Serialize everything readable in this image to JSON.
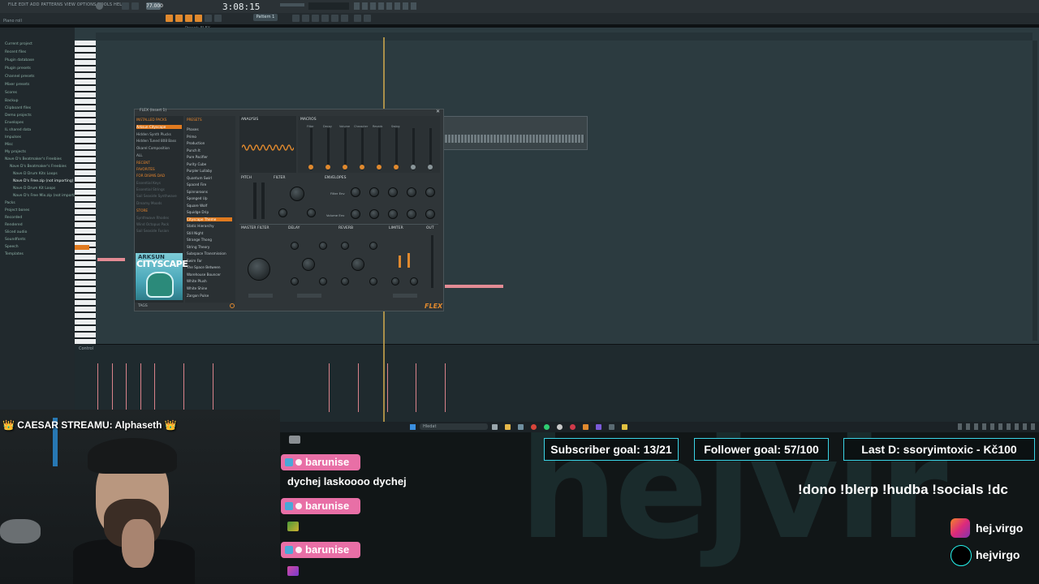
{
  "daw": {
    "menu": "FILE EDIT ADD PATTERNS VIEW OPTIONS TOOLS HELP",
    "tempo": "77.000",
    "time": "3:08:15",
    "pattern": "Pattern 1",
    "hint": "Piano roll",
    "hint2": "Preset: FLEX",
    "browser": {
      "items": [
        "Current project",
        "Recent files",
        "Plugin database",
        "Plugin presets",
        "Channel presets",
        "Mixer presets",
        "Scores",
        "Backup",
        "Clipboard files",
        "Demo projects",
        "Envelopes",
        "IL shared data",
        "Impulses",
        "Misc",
        "My projects",
        "Nave D's Beatmaker's Freebies",
        "Nave D's Beatmaker's Freebies",
        "Nave D Drum Kits Loops",
        "Nave D's Free.zip (not importing)",
        "Nave D Drum Kit Loops",
        "Nave D's Free Mix.zip (not importing)",
        "Packs",
        "Project bones",
        "Recorded",
        "Rendered",
        "Sliced audio",
        "Soundfonts",
        "Speech",
        "Templates"
      ]
    },
    "control_label": "Control",
    "taskbar_search": "Hledat"
  },
  "flex": {
    "title": "FLEX (Insert 1)",
    "packs_header": "INSTALLED PACKS",
    "packs": [
      "Arksun Cityscape",
      "Hidden Synth Plucks",
      "Hidden Tuned 808 Bass",
      "Okarel Composition",
      "ALL",
      "RECENT",
      "FAVORITES",
      "FOR DISMIS DAD",
      "Essential Keys",
      "Essential Strings",
      "Sail Seaside Synthwave",
      "Dreamy Moods",
      "STORE",
      "Synthwave Rhodes",
      "Wind Octopus Pack",
      "Sail Seaside Fusion"
    ],
    "presets_header": "PRESETS",
    "presets": [
      "Phases",
      "Primo",
      "Production",
      "Punch It",
      "Pure Pacifier",
      "Purity Cube",
      "Purpler Lullaby",
      "Quantum Swirl",
      "Spaced Fire",
      "Spinnaroons",
      "Sponged Up",
      "Square Wolf",
      "Squidge Drip",
      "Cityscape Theme",
      "Static Hierarchy",
      "Still Night",
      "Strange Thong",
      "String Theory",
      "Subspace Transmission",
      "Swim Far",
      "The Space Between",
      "Warehouse Bouncer",
      "White Plush",
      "White Shine",
      "Zargon Pulse"
    ],
    "art_top": "ARKSUN",
    "art_main": "CITYSCAPE",
    "sections": {
      "analysis": "ANALYSIS",
      "macros": "MACROS",
      "pitch": "PITCH",
      "filter": "FILTER",
      "envelopes": "ENVELOPES",
      "master_filter": "MASTER FILTER",
      "delay": "DELAY",
      "reverb": "REVERB",
      "limiter": "LIMITER",
      "out": "OUT"
    },
    "macro_labels": [
      "Filter",
      "Decay",
      "Volume",
      "Character",
      "Reverb",
      "Swing"
    ],
    "env_labels": [
      "Filter Env",
      "Volume Env"
    ],
    "footer": "TAGS",
    "logo": "FLEX"
  },
  "stream": {
    "caesar": "👑 CAESAR STREAMU: Alphaseth 👑",
    "subscriber_goal": "Subscriber goal: 13/21",
    "follower_goal": "Follower goal: 57/100",
    "last_donation": "Last D: ssoryimtoxic - Kč100",
    "commands": "!dono !blerp !hudba !socials !dc",
    "instagram": "hej.virgo",
    "tiktok": "hejvirgo",
    "chat": [
      {
        "user": "barunise",
        "message": "dychej laskoooo dychej"
      },
      {
        "user": "barunise",
        "message": ""
      },
      {
        "user": "barunise",
        "message": ""
      }
    ],
    "colors": {
      "goal_border": "#3ad4e6",
      "chat_name_bg": "#e86fa6",
      "accent": "#e0892e"
    }
  }
}
